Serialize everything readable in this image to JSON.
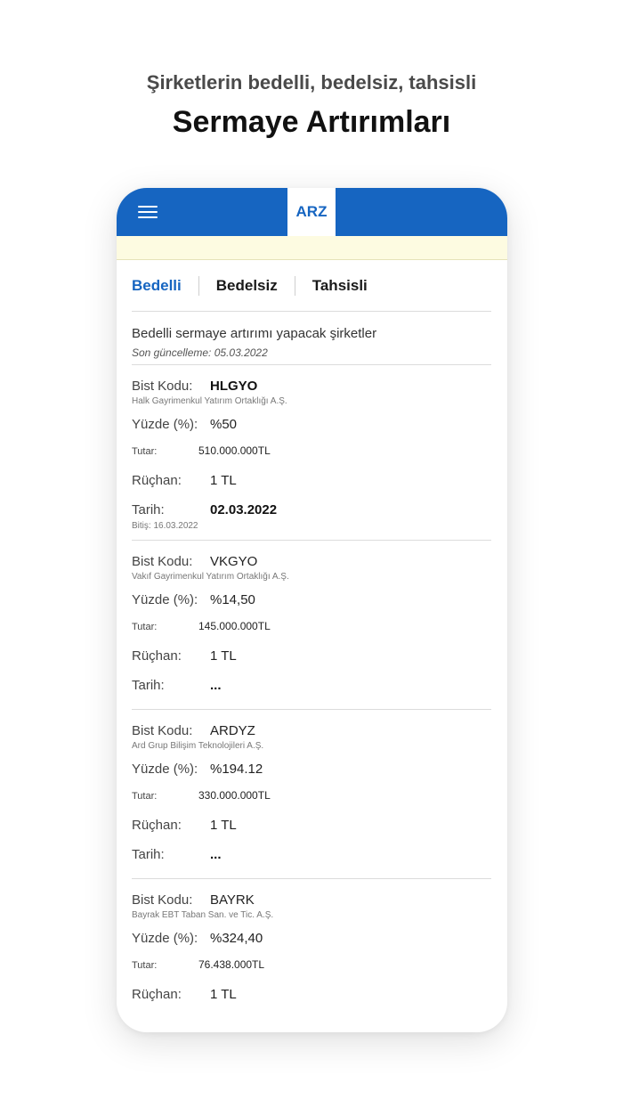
{
  "hero": {
    "subtitle": "Şirketlerin bedelli, bedelsiz, tahsisli",
    "title": "Sermaye Artırımları"
  },
  "app": {
    "logo": "ARZ",
    "menu_icon": "hamburger-menu-icon",
    "brand_color": "#1665c1",
    "notice_color": "#fdfbe1"
  },
  "tabs": [
    {
      "label": "Bedelli",
      "active": true
    },
    {
      "label": "Bedelsiz",
      "active": false
    },
    {
      "label": "Tahsisli",
      "active": false
    }
  ],
  "section": {
    "title": "Bedelli sermaye artırımı yapacak şirketler",
    "updated": "Son güncelleme: 05.03.2022"
  },
  "labels": {
    "code": "Bist Kodu:",
    "percent": "Yüzde (%):",
    "amount": "Tutar:",
    "rights": "Rüçhan:",
    "date": "Tarih:"
  },
  "items": [
    {
      "code": "HLGYO",
      "company": "Halk Gayrimenkul Yatırım Ortaklığı A.Ş.",
      "percent": "%50",
      "amount": "510.000.000TL",
      "rights": "1 TL",
      "date": "02.03.2022",
      "end": "Bitiş: 16.03.2022"
    },
    {
      "code": "VKGYO",
      "company": "Vakıf Gayrimenkul Yatırım Ortaklığı A.Ş.",
      "percent": "%14,50",
      "amount": "145.000.000TL",
      "rights": "1 TL",
      "date": "..."
    },
    {
      "code": "ARDYZ",
      "company": "Ard Grup Bilişim Teknolojileri A.Ş.",
      "percent": "%194.12",
      "amount": "330.000.000TL",
      "rights": "1 TL",
      "date": "..."
    },
    {
      "code": "BAYRK",
      "company": "Bayrak EBT Taban San. ve Tic. A.Ş.",
      "percent": "%324,40",
      "amount": "76.438.000TL",
      "rights": "1 TL"
    }
  ]
}
